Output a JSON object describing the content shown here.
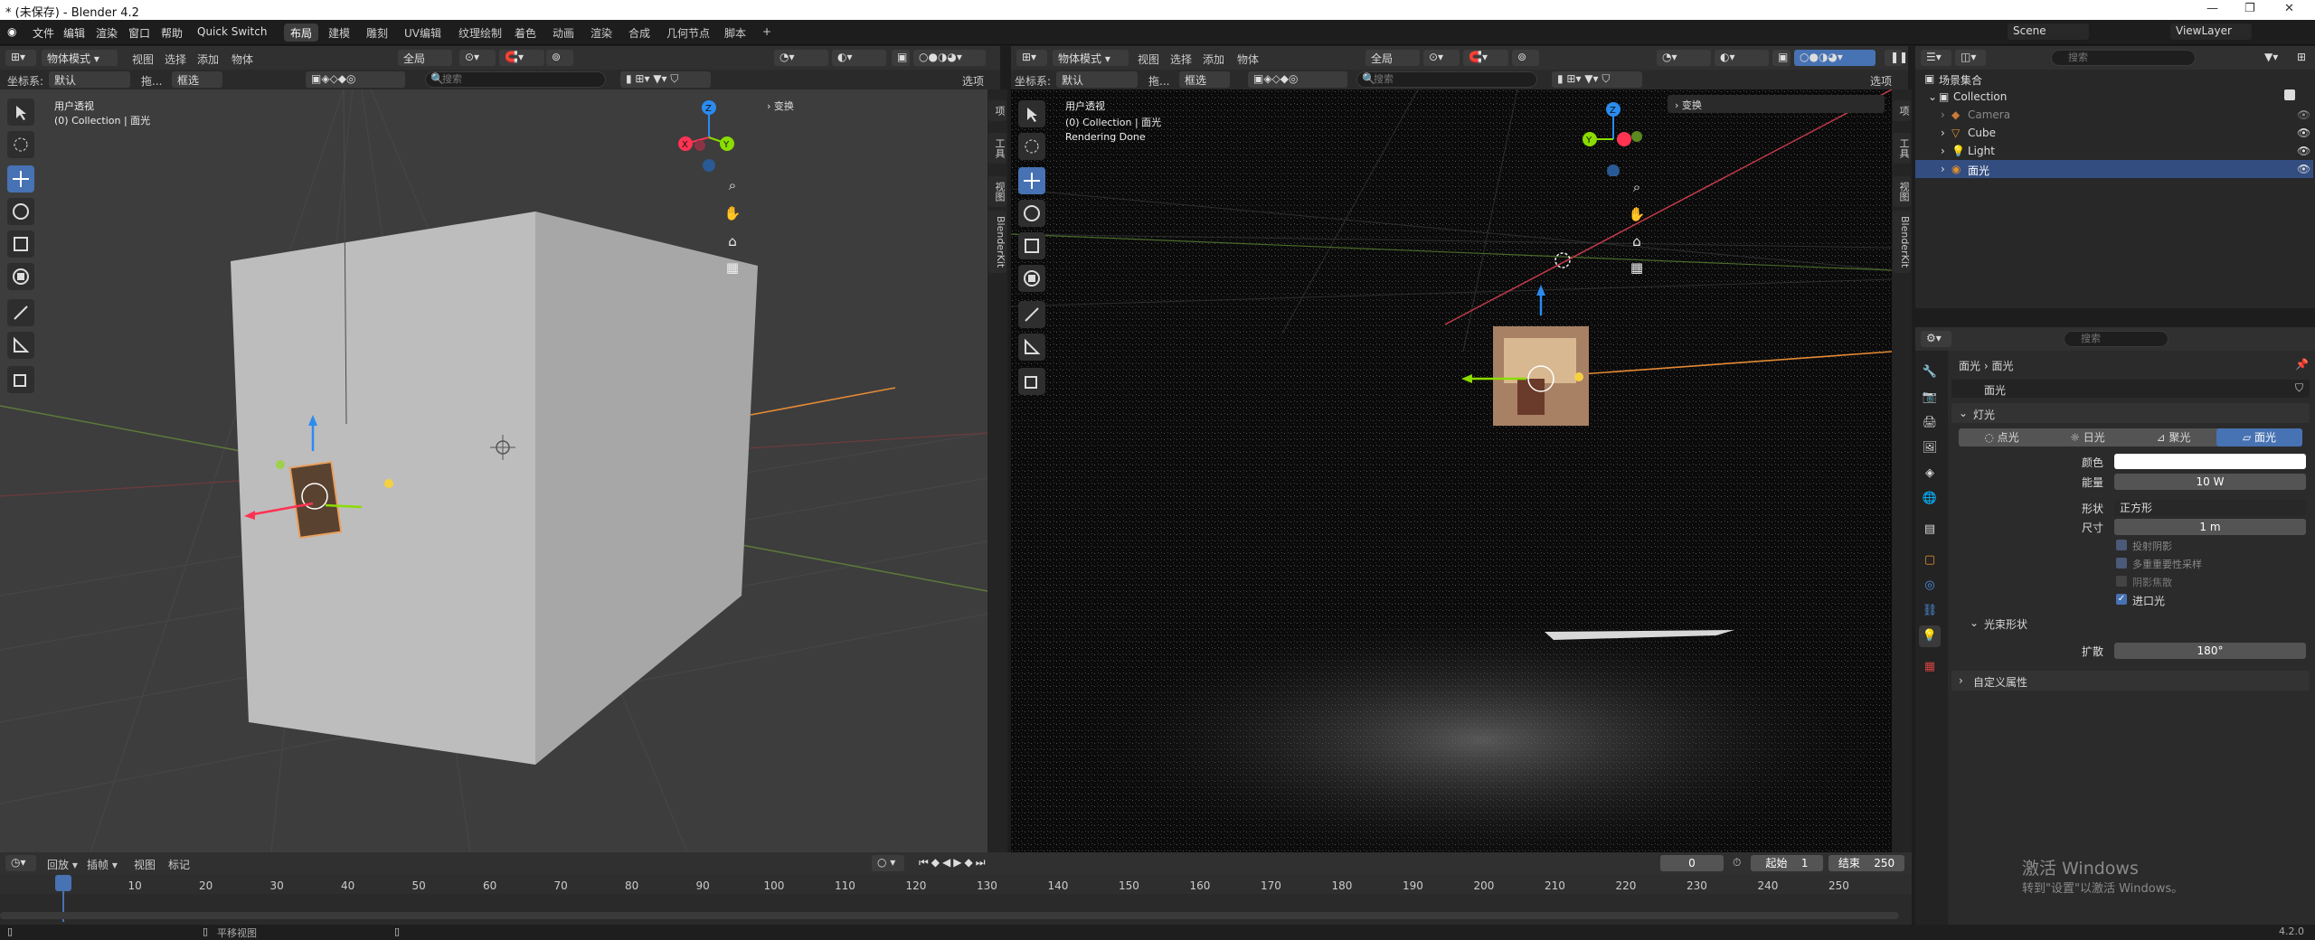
{
  "window": {
    "title": "* (未保存) - Blender 4.2"
  },
  "menu": {
    "items": [
      "文件",
      "编辑",
      "渲染",
      "窗口",
      "帮助",
      "Quick Switch"
    ],
    "workspaces": [
      "布局",
      "建模",
      "雕刻",
      "UV编辑",
      "纹理绘制",
      "着色",
      "动画",
      "渲染",
      "合成",
      "几何节点",
      "脚本"
    ],
    "active_workspace": "布局",
    "add_tab": "+",
    "scene": "Scene",
    "view_layer": "ViewLayer"
  },
  "left_view": {
    "mode": "物体模式",
    "menus": [
      "视图",
      "选择",
      "添加",
      "物体"
    ],
    "transform_global": "全局",
    "coord_label": "坐标系:",
    "coord_value": "默认",
    "drag_label": "拖...",
    "select_mode": "框选",
    "search_placeholder": "搜索",
    "options": "选项",
    "overlay_title": "用户透视",
    "overlay_sub": "(0) Collection | 面光",
    "transform_panel": "变换"
  },
  "right_view": {
    "mode": "物体模式",
    "menus": [
      "视图",
      "选择",
      "添加",
      "物体"
    ],
    "transform_global": "全局",
    "coord_label": "坐标系:",
    "coord_value": "默认",
    "drag_label": "拖...",
    "select_mode": "框选",
    "search_placeholder": "搜索",
    "options": "选项",
    "overlay_title": "用户透视",
    "overlay_sub": "(0) Collection | 面光",
    "overlay_status": "Rendering Done",
    "transform_panel": "变换"
  },
  "side_tabs": [
    "项",
    "工具",
    "视图",
    "BlenderKit"
  ],
  "outliner": {
    "search_placeholder": "搜索",
    "root": "场景集合",
    "collection": "Collection",
    "items": [
      {
        "name": "Camera",
        "selected": false,
        "dim": true
      },
      {
        "name": "Cube",
        "selected": false,
        "dim": false
      },
      {
        "name": "Light",
        "selected": false,
        "dim": false
      },
      {
        "name": "面光",
        "selected": true,
        "dim": false
      }
    ]
  },
  "properties": {
    "search_placeholder": "搜索",
    "breadcrumb": [
      "面光",
      "面光"
    ],
    "datablock": "面光",
    "panel_light": "灯光",
    "light_types": [
      "点光",
      "日光",
      "聚光",
      "面光"
    ],
    "active_light_type": "面光",
    "color_label": "颜色",
    "color_value": "#ffffff",
    "energy_label": "能量",
    "energy_value": "10 W",
    "shape_label": "形状",
    "shape_value": "正方形",
    "size_label": "尺寸",
    "size_value": "1 m",
    "cast_shadow": "投射阴影",
    "mis": "多重重要性采样",
    "shadow_caustics": "阴影焦散",
    "portal": "进口光",
    "beam_shape": "光束形状",
    "spread_label": "扩散",
    "spread_value": "180°",
    "custom_props": "自定义属性"
  },
  "timeline": {
    "menus": [
      "回放",
      "插帧",
      "视图",
      "标记"
    ],
    "current_frame": "0",
    "start_label": "起始",
    "start_value": "1",
    "end_label": "结束",
    "end_value": "250",
    "ticks": [
      "0",
      "10",
      "20",
      "30",
      "40",
      "50",
      "60",
      "70",
      "80",
      "90",
      "100",
      "110",
      "120",
      "130",
      "140",
      "150",
      "160",
      "170",
      "180",
      "190",
      "200",
      "210",
      "220",
      "230",
      "240",
      "250"
    ]
  },
  "statusbar": {
    "pan": "平移视图",
    "version": "4.2.0"
  },
  "watermark": {
    "title": "激活 Windows",
    "sub": "转到\"设置\"以激活 Windows。"
  },
  "colors": {
    "accent": "#4772b3",
    "selected_row": "#334d80",
    "axis_x": "#ff3352",
    "axis_y": "#8bdc00",
    "axis_z": "#2b8cf0"
  }
}
